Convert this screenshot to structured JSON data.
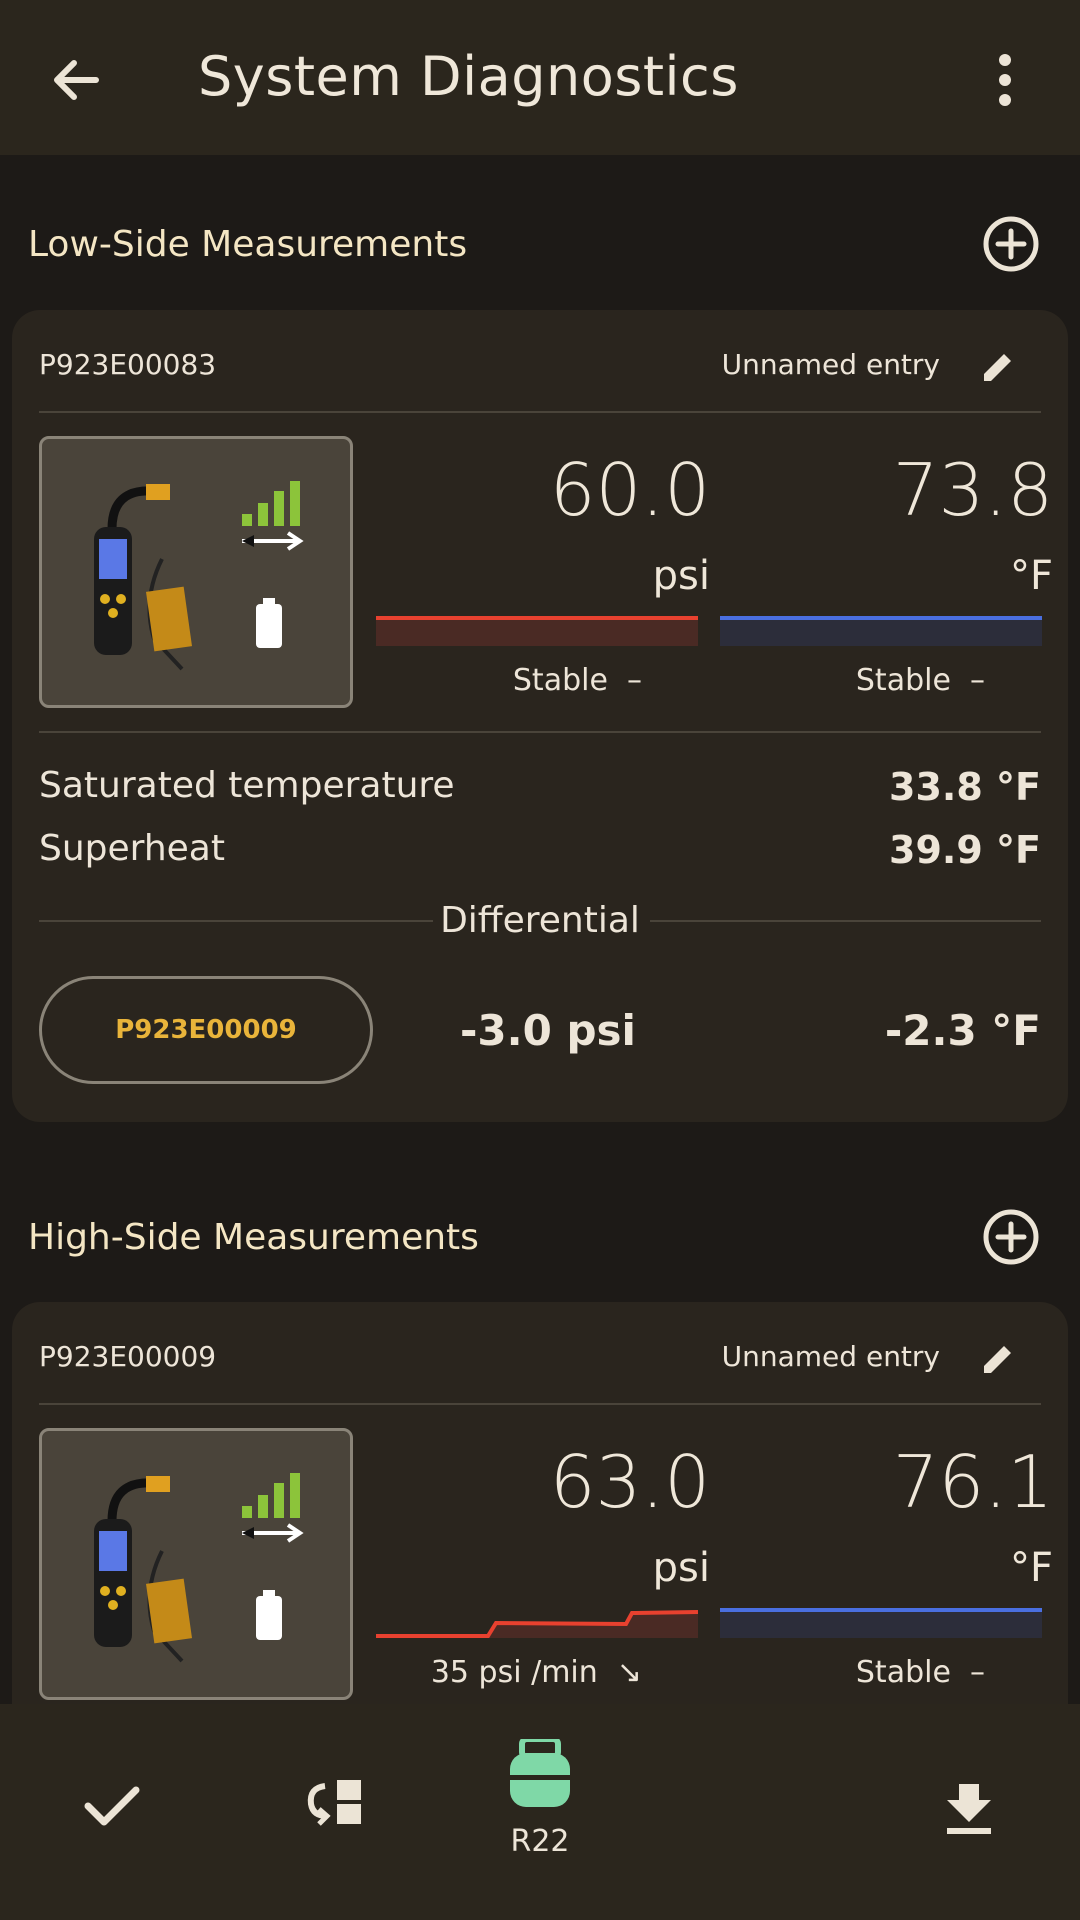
{
  "appbar": {
    "title": "System Diagnostics"
  },
  "low_side": {
    "section_title": "Low-Side Measurements",
    "serial": "P923E00083",
    "entry_name": "Unnamed entry",
    "pressure": {
      "value": "60.0",
      "unit": "psi",
      "status": "Stable",
      "trend_symbol": "–"
    },
    "temperature": {
      "value": "73.8",
      "unit": "°F",
      "status": "Stable",
      "trend_symbol": "–"
    },
    "saturated_label": "Saturated temperature",
    "saturated_value": "33.8 °F",
    "superheat_label": "Superheat",
    "superheat_value": "39.9 °F",
    "differential_label": "Differential",
    "differential_chip": "P923E00009",
    "diff_pressure": "-3.0 psi",
    "diff_temperature": "-2.3 °F"
  },
  "high_side": {
    "section_title": "High-Side Measurements",
    "serial": "P923E00009",
    "entry_name": "Unnamed entry",
    "pressure": {
      "value": "63.0",
      "unit": "psi",
      "status": "35 psi /min",
      "trend_symbol": "↘"
    },
    "temperature": {
      "value": "76.1",
      "unit": "°F",
      "status": "Stable",
      "trend_symbol": "–"
    }
  },
  "bottom_nav": {
    "refrigerant_label": "R22"
  },
  "colors": {
    "pressure_line": "#e8412f",
    "temperature_line": "#4a6fe0",
    "refrigerant_icon": "#7fd8a7",
    "chip_text": "#e9b43a",
    "signal_bars": "#8cc43a"
  }
}
